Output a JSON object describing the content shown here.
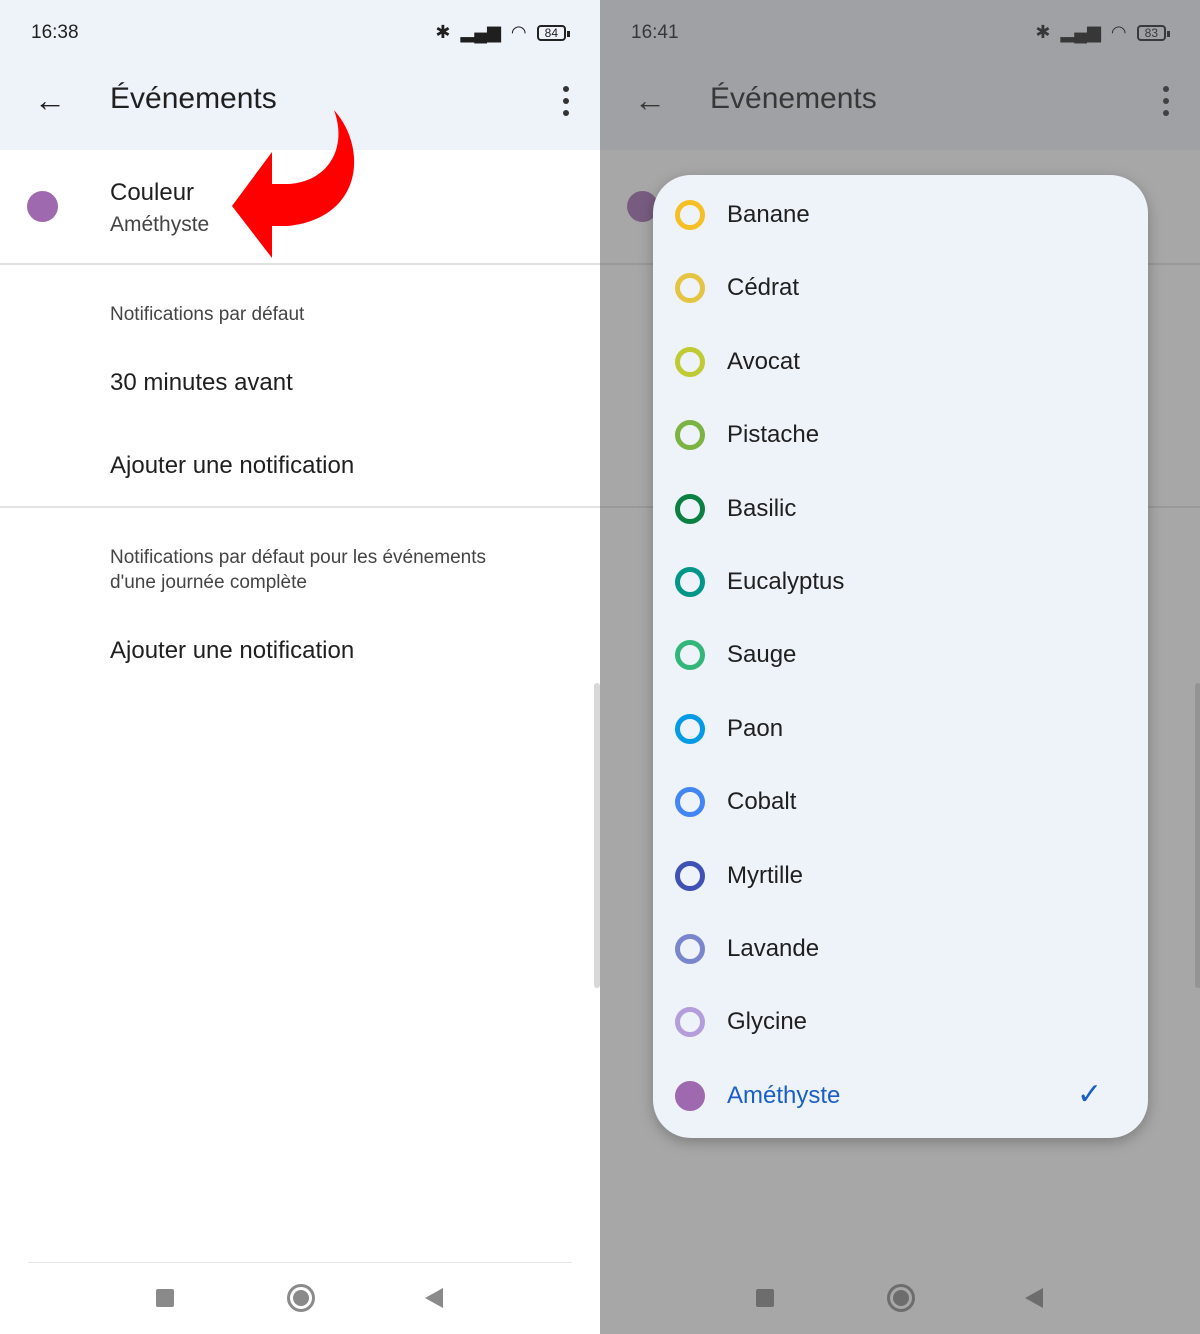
{
  "left": {
    "status": {
      "time": "16:38",
      "battery": "84"
    },
    "header": {
      "title": "Événements"
    },
    "color_setting": {
      "label": "Couleur",
      "value": "Améthyste",
      "color": "#9e69af"
    },
    "section1": {
      "heading": "Notifications par défaut",
      "items": [
        "30 minutes avant",
        "Ajouter une notification"
      ]
    },
    "section2": {
      "heading_line1": "Notifications par défaut pour les événements",
      "heading_line2": "d'une journée complète",
      "items": [
        "Ajouter une notification"
      ]
    },
    "annotation_arrow_color": "#ff0000"
  },
  "right": {
    "status": {
      "time": "16:41",
      "battery": "83"
    },
    "header": {
      "title": "Événements"
    },
    "color_dialog": {
      "selected": "Améthyste",
      "options": [
        {
          "label": "Banane",
          "color": "#f6bf26"
        },
        {
          "label": "Cédrat",
          "color": "#e4c441"
        },
        {
          "label": "Avocat",
          "color": "#c0ca33"
        },
        {
          "label": "Pistache",
          "color": "#7cb342"
        },
        {
          "label": "Basilic",
          "color": "#0b8043"
        },
        {
          "label": "Eucalyptus",
          "color": "#009688"
        },
        {
          "label": "Sauge",
          "color": "#33b679"
        },
        {
          "label": "Paon",
          "color": "#039be5"
        },
        {
          "label": "Cobalt",
          "color": "#4285f4"
        },
        {
          "label": "Myrtille",
          "color": "#3f51b5"
        },
        {
          "label": "Lavande",
          "color": "#7986cb"
        },
        {
          "label": "Glycine",
          "color": "#b39ddb"
        },
        {
          "label": "Améthyste",
          "color": "#9e69af"
        }
      ]
    }
  }
}
